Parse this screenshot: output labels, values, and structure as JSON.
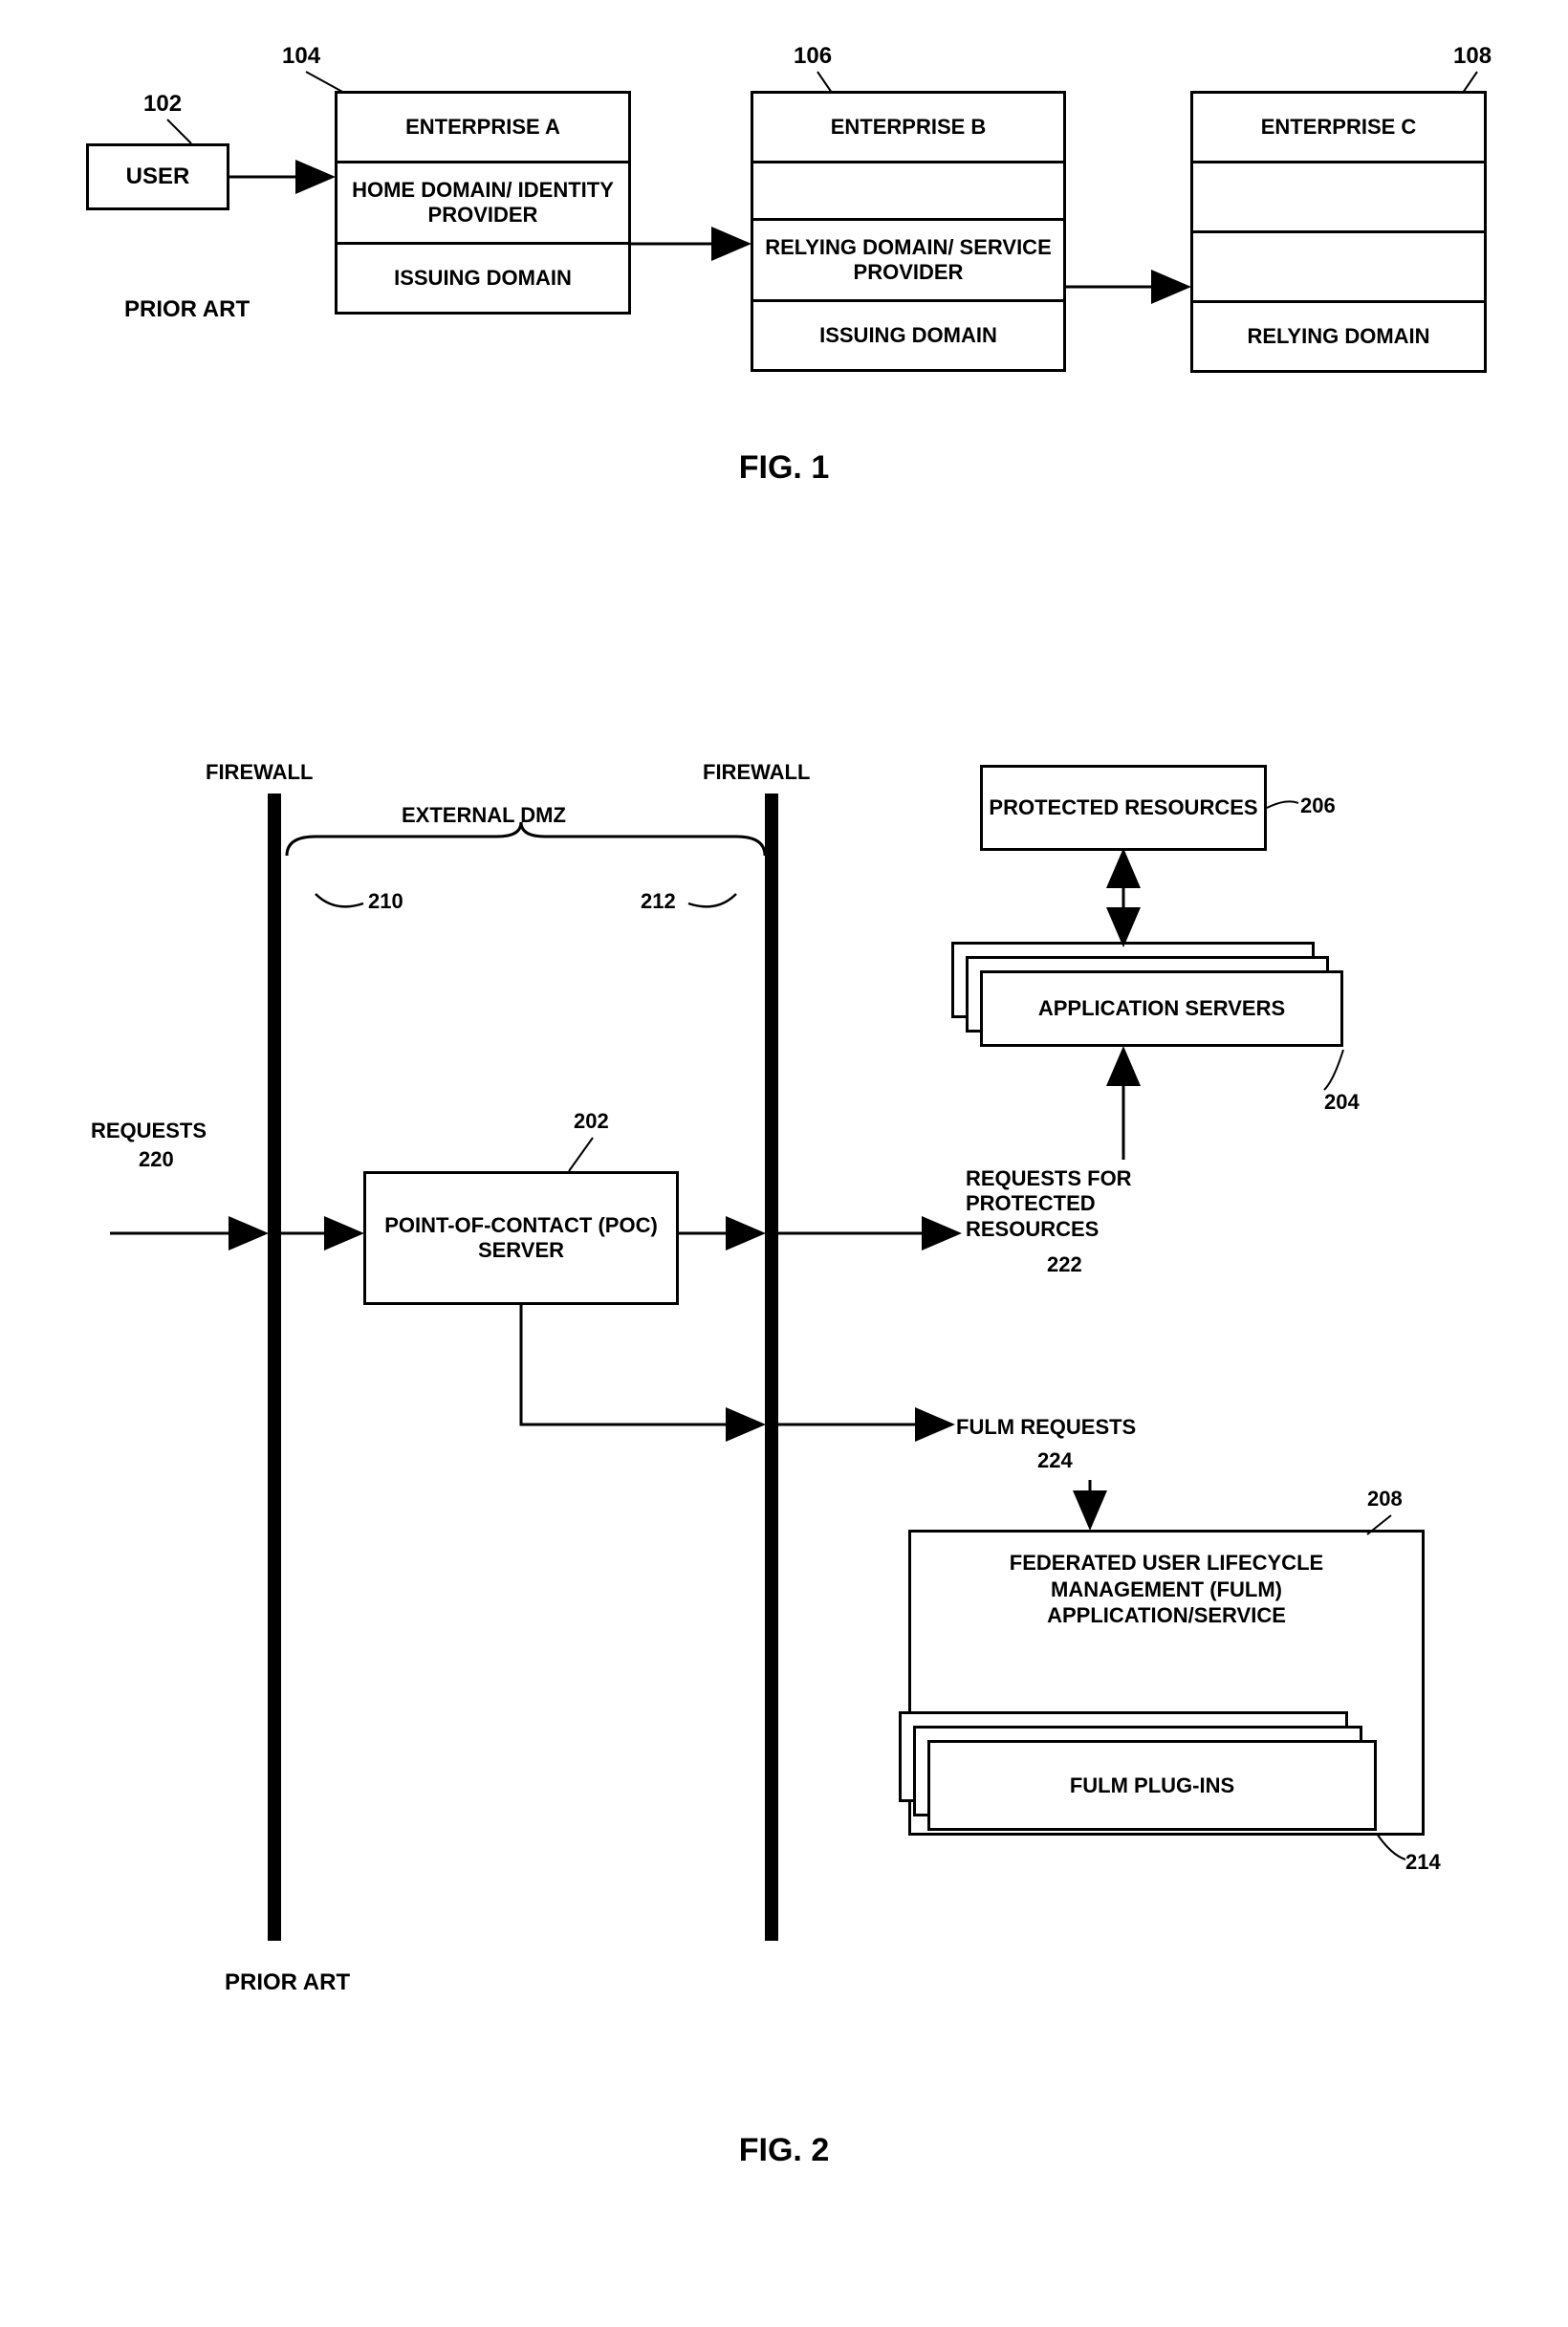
{
  "fig1": {
    "title": "FIG. 1",
    "prior_art": "PRIOR ART",
    "user": {
      "label": "USER",
      "ref": "102"
    },
    "entA": {
      "ref": "104",
      "rows": [
        "ENTERPRISE A",
        "HOME DOMAIN/ IDENTITY PROVIDER",
        "ISSUING DOMAIN"
      ]
    },
    "entB": {
      "ref": "106",
      "rows": [
        "ENTERPRISE B",
        "",
        "RELYING DOMAIN/ SERVICE PROVIDER",
        "ISSUING DOMAIN"
      ]
    },
    "entC": {
      "ref": "108",
      "rows": [
        "ENTERPRISE C",
        "",
        "",
        "RELYING DOMAIN"
      ]
    }
  },
  "fig2": {
    "title": "FIG. 2",
    "prior_art": "PRIOR ART",
    "firewall_left": "FIREWALL",
    "firewall_right": "FIREWALL",
    "dmz": "EXTERNAL DMZ",
    "ref210": "210",
    "ref212": "212",
    "requests": {
      "label": "REQUESTS",
      "ref": "220"
    },
    "poc": {
      "label": "POINT-OF-CONTACT (POC) SERVER",
      "ref": "202"
    },
    "protected": {
      "label": "PROTECTED RESOURCES",
      "ref": "206"
    },
    "appservers": {
      "label": "APPLICATION SERVERS",
      "ref": "204"
    },
    "req_protected": {
      "label": "REQUESTS FOR PROTECTED RESOURCES",
      "ref": "222"
    },
    "fulm_req": {
      "label": "FULM REQUESTS",
      "ref": "224"
    },
    "fulm": {
      "label": "FEDERATED USER LIFECYCLE MANAGEMENT (FULM) APPLICATION/SERVICE",
      "ref": "208"
    },
    "plugins": {
      "label": "FULM PLUG-INS",
      "ref": "214"
    }
  }
}
